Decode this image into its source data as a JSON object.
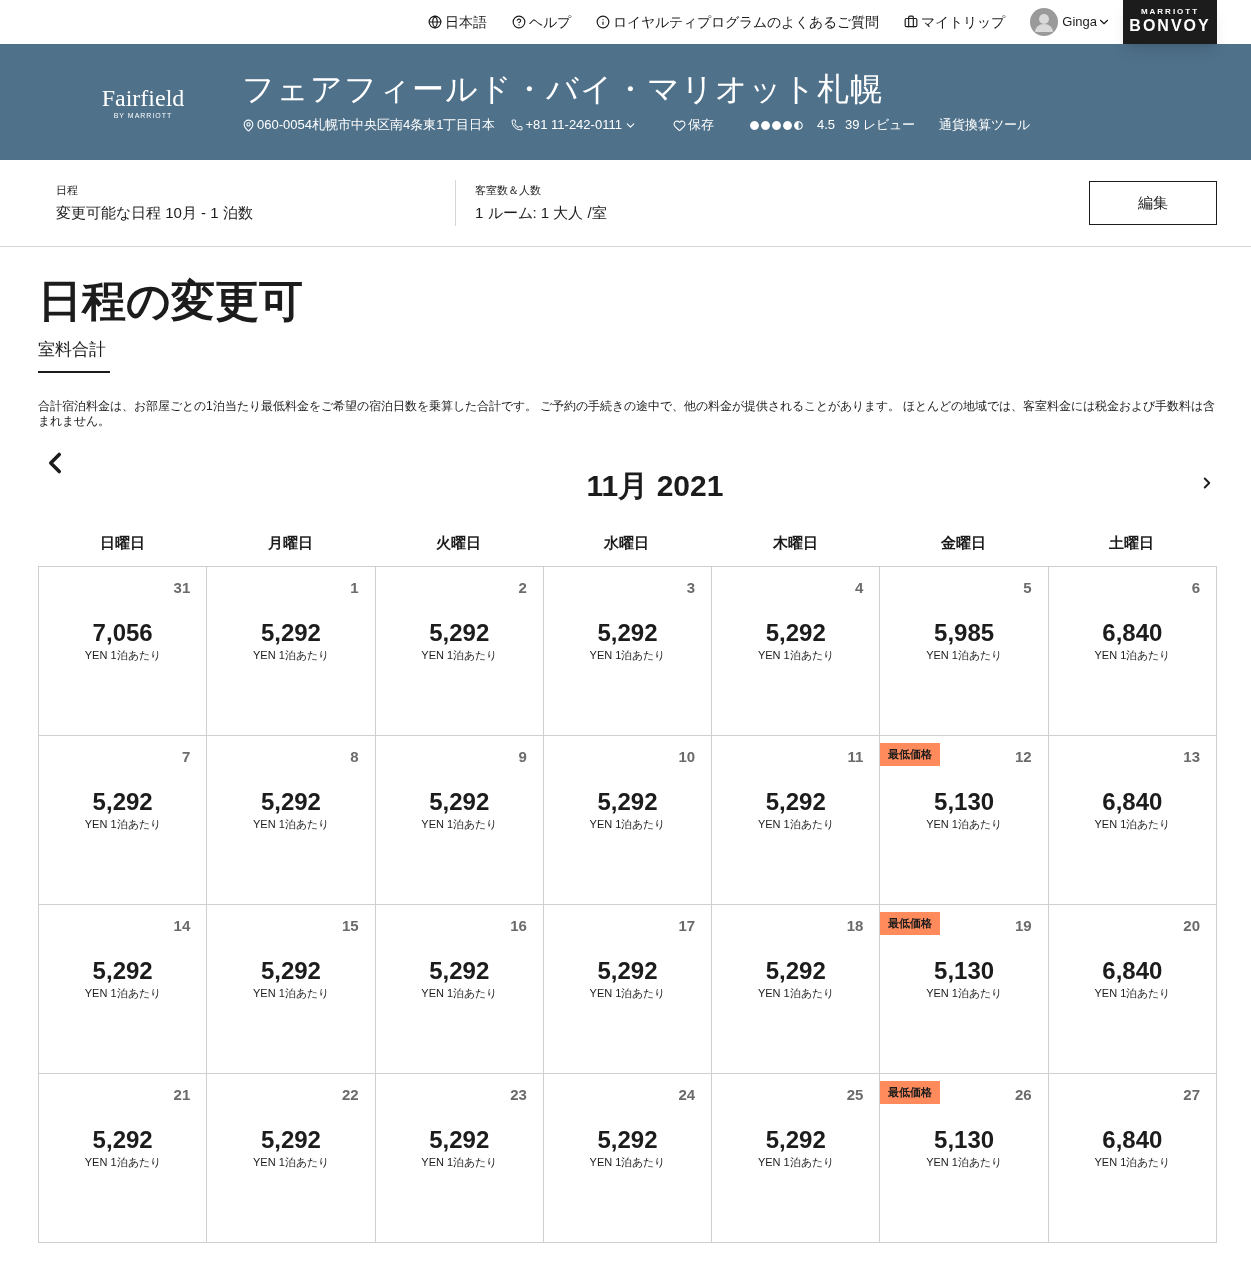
{
  "top_nav": [
    {
      "kind": "globe",
      "label": "日本語"
    },
    {
      "kind": "help",
      "label": "ヘルプ"
    },
    {
      "kind": "info",
      "label": "ロイヤルティプログラムのよくあるご質問"
    },
    {
      "kind": "suitcase",
      "label": "マイトリップ"
    }
  ],
  "user": {
    "name": "Ginga"
  },
  "brand": {
    "top": "MARRIOTT",
    "main": "BONVOY"
  },
  "hotel": {
    "logo": "Fairfield",
    "logo_sub": "BY MARRIOTT",
    "name": "フェアフィールド・バイ・マリオット札幌",
    "address": "060-0054札幌市中央区南4条東1丁目日本",
    "phone": "+81 11-242-0111",
    "save": "保存",
    "stars": 4.5,
    "rating": "4.5",
    "reviews": "39 レビュー",
    "currency_tool": "通貨換算ツール"
  },
  "search": {
    "dates_label": "日程",
    "dates_value": "変更可能な日程 10月 - 1 泊数",
    "rooms_label": "客室数＆人数",
    "rooms_value": "1 ルーム: 1 大人 /室",
    "edit": "編集"
  },
  "page_title": "日程の変更可",
  "tabs": [
    {
      "label": "室料合計",
      "selected": true
    }
  ],
  "disclaimer": "合計宿泊料金は、お部屋ごとの1泊当たり最低料金をご希望の宿泊日数を乗算した合計です。 ご予約の手続きの途中で、他の料金が提供されることがあります。 ほとんどの地域では、客室料金には税金および手数料は含まれません。",
  "calendar": {
    "month": "11月 2021",
    "weekdays": [
      "日曜日",
      "月曜日",
      "火曜日",
      "水曜日",
      "木曜日",
      "金曜日",
      "土曜日"
    ],
    "weeks": [
      [
        {
          "day": "31",
          "price": "7,056",
          "unit": "YEN 1泊あたり"
        },
        {
          "day": "1",
          "price": "5,292",
          "unit": "YEN 1泊あたり"
        },
        {
          "day": "2",
          "price": "5,292",
          "unit": "YEN 1泊あたり"
        },
        {
          "day": "3",
          "price": "5,292",
          "unit": "YEN 1泊あたり"
        },
        {
          "day": "4",
          "price": "5,292",
          "unit": "YEN 1泊あたり"
        },
        {
          "day": "5",
          "price": "5,985",
          "unit": "YEN 1泊あたり"
        },
        {
          "day": "6",
          "price": "6,840",
          "unit": "YEN 1泊あたり"
        }
      ],
      [
        {
          "day": "7",
          "price": "5,292",
          "unit": "YEN 1泊あたり"
        },
        {
          "day": "8",
          "price": "5,292",
          "unit": "YEN 1泊あたり"
        },
        {
          "day": "9",
          "price": "5,292",
          "unit": "YEN 1泊あたり"
        },
        {
          "day": "10",
          "price": "5,292",
          "unit": "YEN 1泊あたり"
        },
        {
          "day": "11",
          "price": "5,292",
          "unit": "YEN 1泊あたり"
        },
        {
          "day": "12",
          "price": "5,130",
          "unit": "YEN 1泊あたり",
          "badge": "最低価格"
        },
        {
          "day": "13",
          "price": "6,840",
          "unit": "YEN 1泊あたり"
        }
      ],
      [
        {
          "day": "14",
          "price": "5,292",
          "unit": "YEN 1泊あたり"
        },
        {
          "day": "15",
          "price": "5,292",
          "unit": "YEN 1泊あたり"
        },
        {
          "day": "16",
          "price": "5,292",
          "unit": "YEN 1泊あたり"
        },
        {
          "day": "17",
          "price": "5,292",
          "unit": "YEN 1泊あたり"
        },
        {
          "day": "18",
          "price": "5,292",
          "unit": "YEN 1泊あたり"
        },
        {
          "day": "19",
          "price": "5,130",
          "unit": "YEN 1泊あたり",
          "badge": "最低価格"
        },
        {
          "day": "20",
          "price": "6,840",
          "unit": "YEN 1泊あたり"
        }
      ],
      [
        {
          "day": "21",
          "price": "5,292",
          "unit": "YEN 1泊あたり"
        },
        {
          "day": "22",
          "price": "5,292",
          "unit": "YEN 1泊あたり"
        },
        {
          "day": "23",
          "price": "5,292",
          "unit": "YEN 1泊あたり"
        },
        {
          "day": "24",
          "price": "5,292",
          "unit": "YEN 1泊あたり"
        },
        {
          "day": "25",
          "price": "5,292",
          "unit": "YEN 1泊あたり"
        },
        {
          "day": "26",
          "price": "5,130",
          "unit": "YEN 1泊あたり",
          "badge": "最低価格"
        },
        {
          "day": "27",
          "price": "6,840",
          "unit": "YEN 1泊あたり"
        }
      ]
    ]
  }
}
